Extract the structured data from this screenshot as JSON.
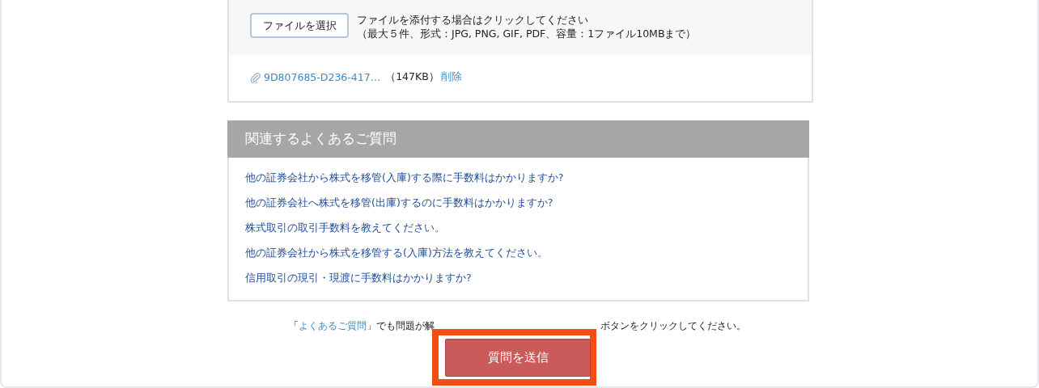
{
  "upload": {
    "button": "ファイルを選択",
    "hint": "ファイルを添付する場合はクリックしてください",
    "limits": "（最大５件、形式：JPG, PNG, GIF, PDF、容量：1ファイル10MBまで）"
  },
  "attachments": [
    {
      "name": "9D807685-D236-417…",
      "size": "（147KB）",
      "delete": "削除"
    }
  ],
  "faq": {
    "title": "関連するよくあるご質問",
    "links": [
      "他の証券会社から株式を移管(入庫)する際に手数料はかかりますか?",
      "他の証券会社へ株式を移管(出庫)するのに手数料はかかりますか?",
      "株式取引の取引手数料を教えてください。",
      "他の証券会社から株式を移管する(入庫)方法を教えてください。",
      "信用取引の現引・現渡に手数料はかかりますか?"
    ]
  },
  "notice": {
    "open": "「",
    "link": "よくあるご質問",
    "before": "」でも問題が解",
    "after": "ボタンをクリックしてください。"
  },
  "submit": {
    "label": "質問を送信",
    "highlighted": true
  }
}
